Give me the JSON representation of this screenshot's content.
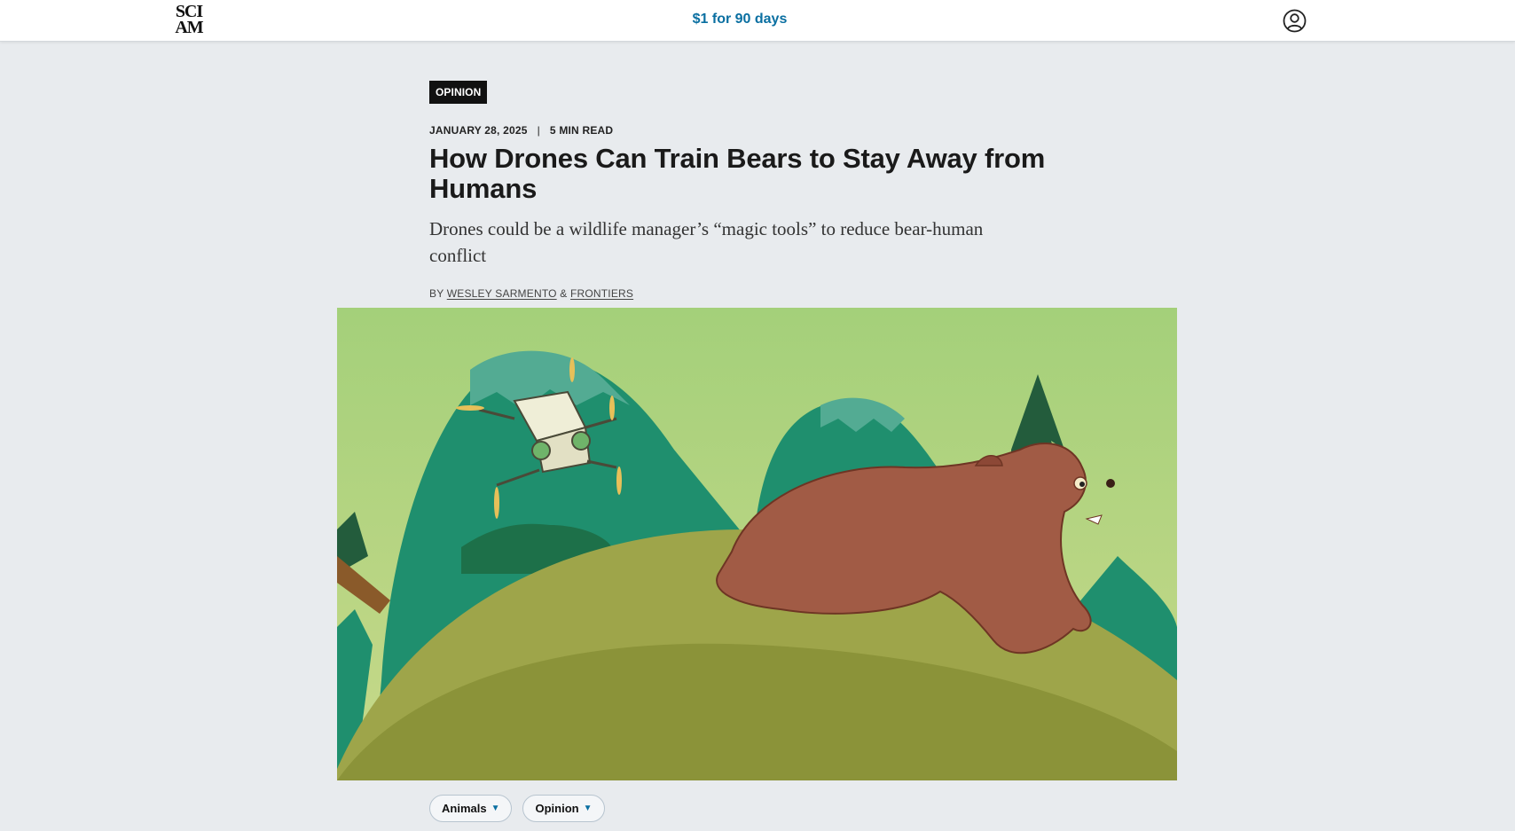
{
  "header": {
    "logo_line1": "SCI",
    "logo_line2": "AM",
    "promo": "$1 for 90 days"
  },
  "article": {
    "section_badge": "OPINION",
    "date": "JANUARY 28, 2025",
    "read_time": "5 MIN READ",
    "title": "How Drones Can Train Bears to Stay Away from Humans",
    "dek": "Drones could be a wildlife manager’s “magic tools” to reduce bear-human conflict",
    "byline_prefix": "BY",
    "authors": [
      "WESLEY SARMENTO",
      "FRONTIERS"
    ],
    "author_joiner": "&"
  },
  "tags": [
    {
      "label": "Animals",
      "icon": "chevron-down-icon"
    },
    {
      "label": "Opinion",
      "icon": "chevron-down-icon"
    }
  ],
  "colors": {
    "accent": "#0a6fa1",
    "background": "#e8ebee",
    "badge": "#111111"
  }
}
